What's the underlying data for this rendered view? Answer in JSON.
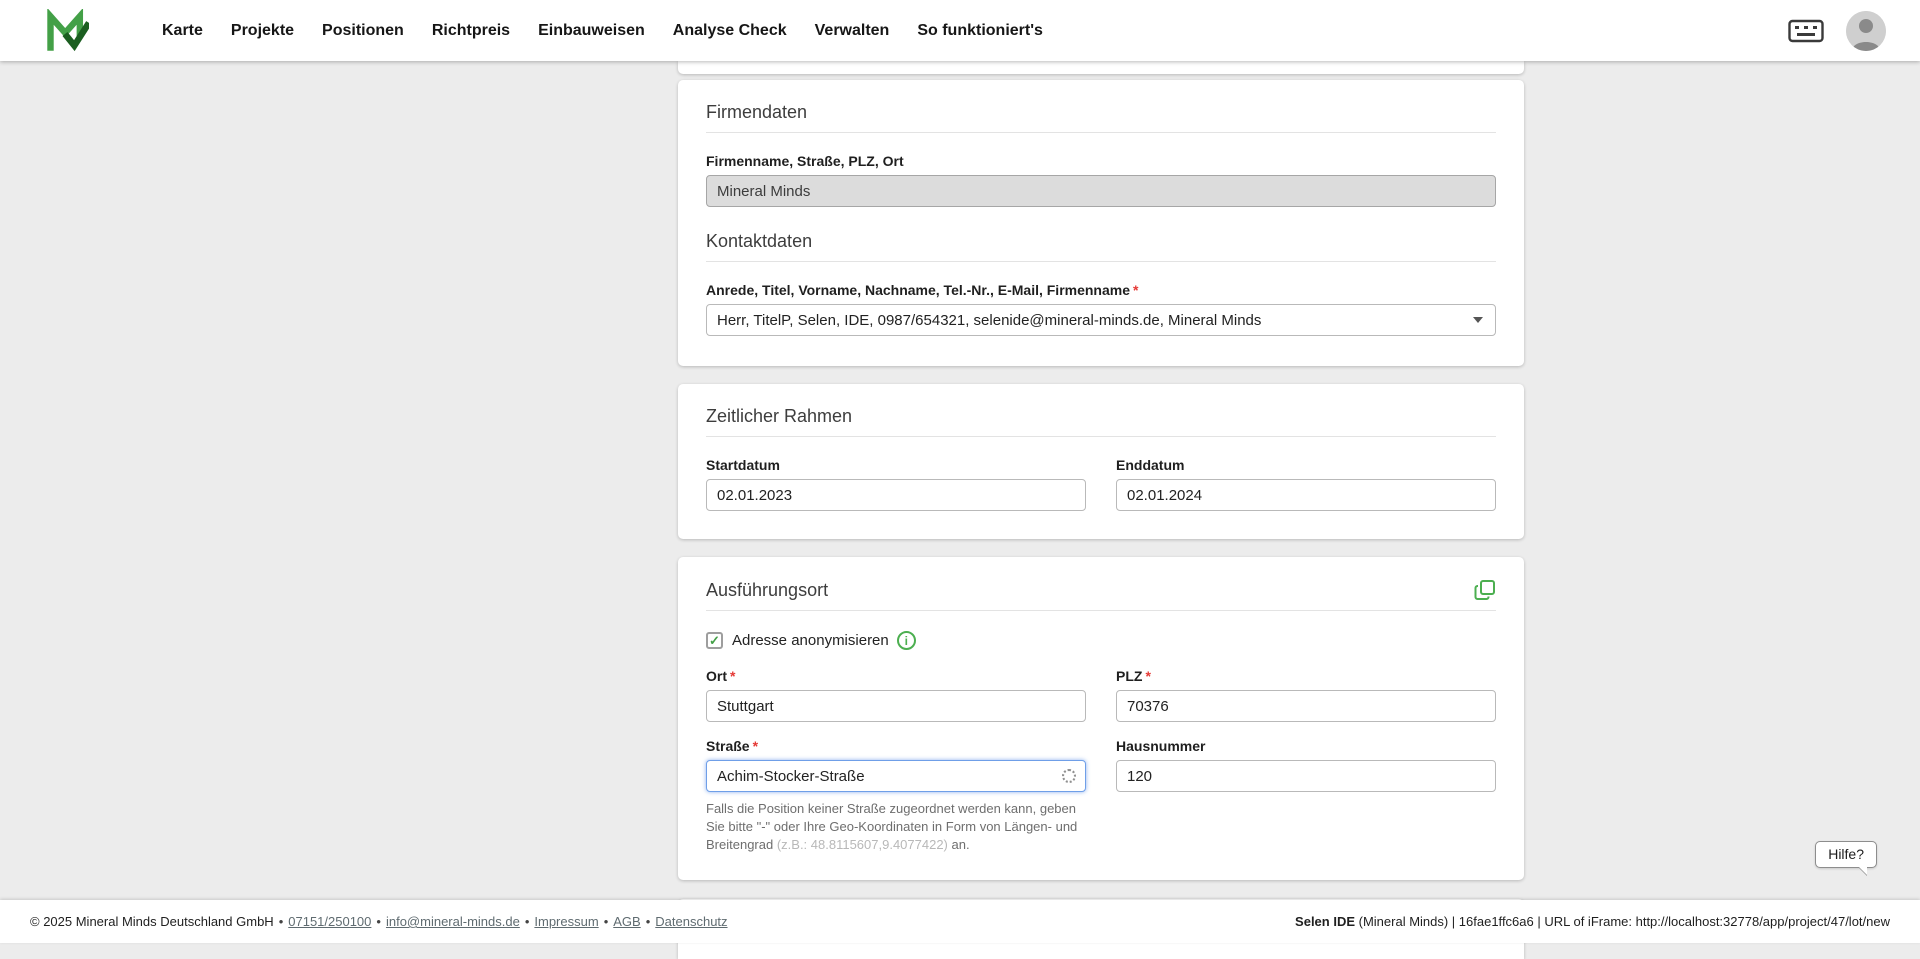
{
  "navbar": {
    "items": [
      "Karte",
      "Projekte",
      "Positionen",
      "Richtpreis",
      "Einbauweisen",
      "Analyse Check",
      "Verwalten",
      "So funktioniert's"
    ]
  },
  "icons": {
    "check": "✓",
    "info": "i"
  },
  "misc": {
    "required_mark": "*"
  },
  "cards": {
    "firmendaten": {
      "title": "Firmendaten",
      "field_label": "Firmenname, Straße, PLZ, Ort",
      "field_value": "Mineral Minds",
      "kontakt_title": "Kontaktdaten",
      "kontakt_label": "Anrede, Titel, Vorname, Nachname, Tel.-Nr., E-Mail, Firmenname",
      "kontakt_value": "Herr, TitelP, Selen, IDE, 0987/654321, selenide@mineral-minds.de, Mineral Minds"
    },
    "zeitraum": {
      "title": "Zeitlicher Rahmen",
      "start_label": "Startdatum",
      "start_value": "02.01.2023",
      "end_label": "Enddatum",
      "end_value": "02.01.2024"
    },
    "ort": {
      "title": "Ausführungsort",
      "checkbox_label": "Adresse anonymisieren",
      "ort_label": "Ort",
      "ort_value": "Stuttgart",
      "plz_label": "PLZ",
      "plz_value": "70376",
      "strasse_label": "Straße",
      "strasse_value": "Achim-Stocker-Straße",
      "hausnummer_label": "Hausnummer",
      "hausnummer_value": "120",
      "helper_text_1": "Falls die Position keiner Straße zugeordnet werden kann, geben Sie bitte \"-\" oder Ihre Geo-Koordinaten in Form von Längen- und Breitengrad ",
      "helper_example": "(z.B.: 48.8115607,9.4077422)",
      "helper_text_2": " an."
    }
  },
  "help_button": {
    "label": "Hilfe?"
  },
  "footer": {
    "copyright": "© 2025 Mineral Minds Deutschland GmbH",
    "separator": "•",
    "phone": "07151/250100",
    "email": "info@mineral-minds.de",
    "links": [
      "Impressum",
      "AGB",
      "Datenschutz"
    ],
    "right_bold": "Selen IDE",
    "right_rest": " (Mineral Minds) | 16fae1ffc6a6 | URL of iFrame: http://localhost:32778/app/project/47/lot/new"
  },
  "colors": {
    "accent_green": "#43a047",
    "focus_blue": "#6f9fe8",
    "required_red": "#e53935",
    "page_background": "#ececec"
  }
}
